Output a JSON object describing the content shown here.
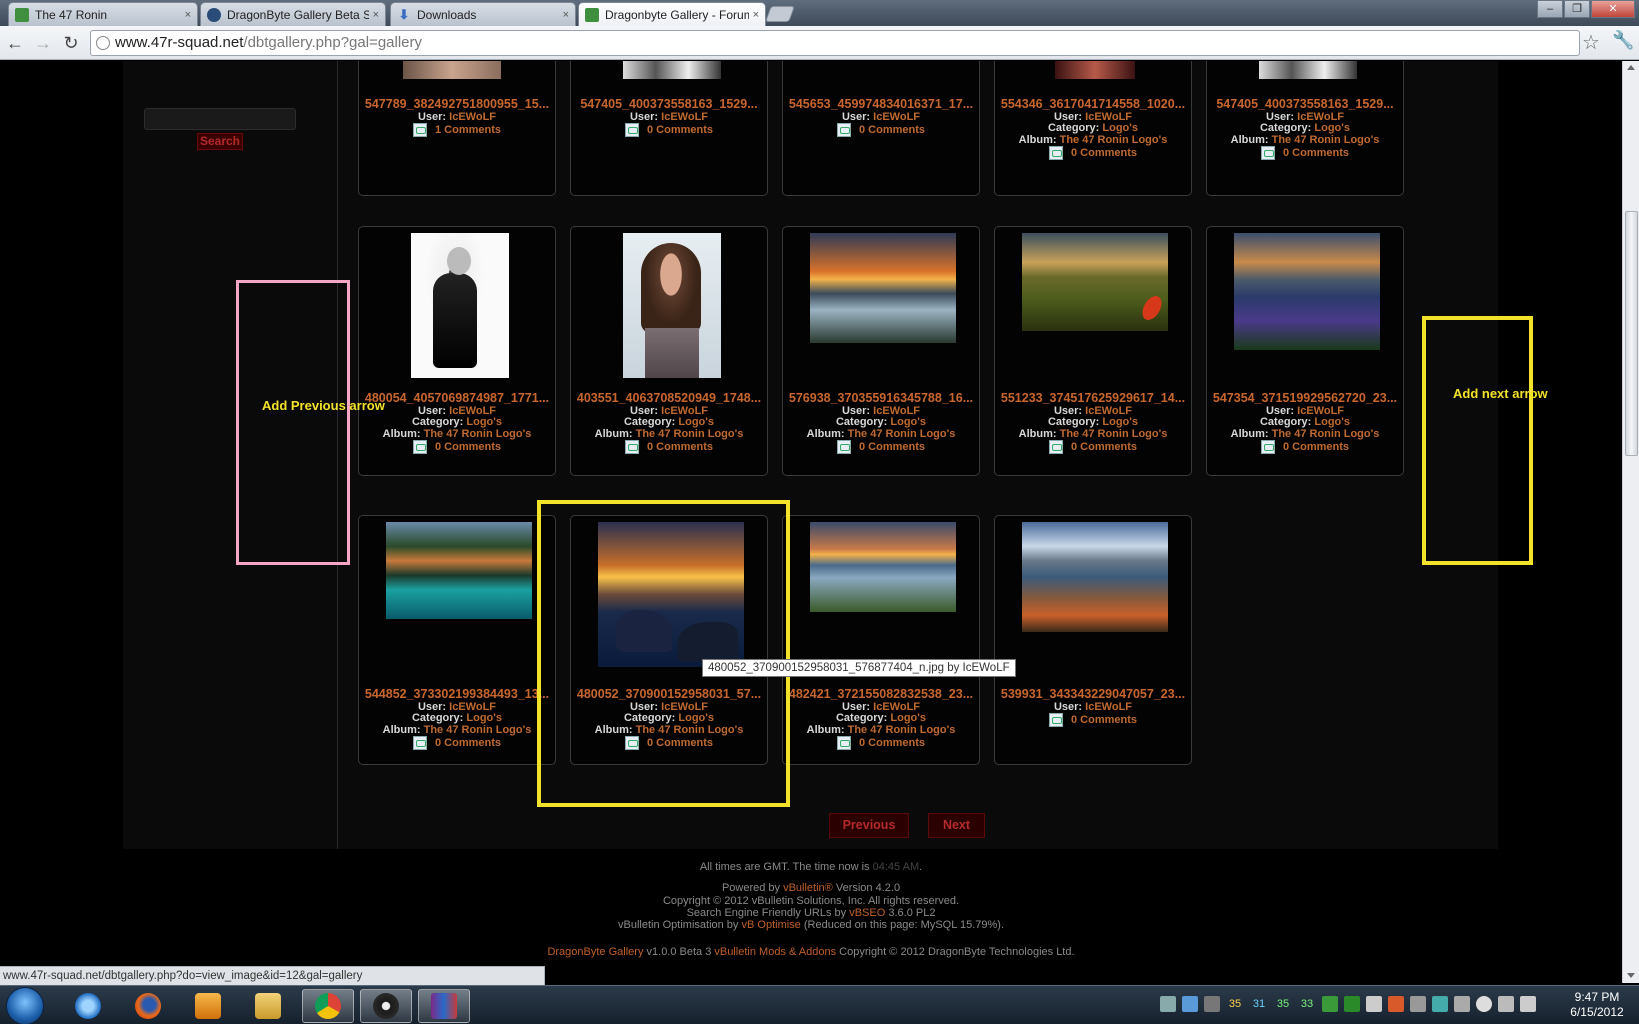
{
  "browser": {
    "tabs": [
      {
        "label": "The 47 Ronin",
        "favicon_color": "#3f8f3f"
      },
      {
        "label": "DragonByte Gallery Beta Su",
        "favicon_color": "#2a4c78"
      },
      {
        "label": "Downloads",
        "favicon_color": "#3b6ec2"
      },
      {
        "label": "Dragonbyte Gallery - Forum",
        "favicon_color": "#3f8f3f"
      }
    ],
    "tab_close_glyph": "×",
    "address_host": "www.47r-squad.net",
    "address_path": "/dbtgallery.php?gal=gallery"
  },
  "sidebar": {
    "search_button": "Search"
  },
  "gallery": {
    "row1": [
      {
        "title": "547789_382492751800955_15...",
        "user_label": "User:",
        "user": "IcEWoLF",
        "comments": "1 Comments"
      },
      {
        "title": "547405_400373558163_1529...",
        "user_label": "User:",
        "user": "IcEWoLF",
        "comments": "0 Comments"
      },
      {
        "title": "545653_459974834016371_17...",
        "user_label": "User:",
        "user": "IcEWoLF",
        "comments": "0 Comments"
      },
      {
        "title": "554346_3617041714558_1020...",
        "user_label": "User:",
        "user": "IcEWoLF",
        "category_label": "Category:",
        "category": "Logo's",
        "album_label": "Album:",
        "album": "The 47 Ronin Logo's",
        "comments": "0 Comments"
      },
      {
        "title": "547405_400373558163_1529...",
        "user_label": "User:",
        "user": "IcEWoLF",
        "category_label": "Category:",
        "category": "Logo's",
        "album_label": "Album:",
        "album": "The 47 Ronin Logo's",
        "comments": "0 Comments"
      }
    ],
    "row2": [
      {
        "title": "480054_4057069874987_1771...",
        "user_label": "User:",
        "user": "IcEWoLF",
        "category_label": "Category:",
        "category": "Logo's",
        "album_label": "Album:",
        "album": "The 47 Ronin Logo's",
        "comments": "0 Comments"
      },
      {
        "title": "403551_4063708520949_1748...",
        "user_label": "User:",
        "user": "IcEWoLF",
        "category_label": "Category:",
        "category": "Logo's",
        "album_label": "Album:",
        "album": "The 47 Ronin Logo's",
        "comments": "0 Comments"
      },
      {
        "title": "576938_370355916345788_16...",
        "user_label": "User:",
        "user": "IcEWoLF",
        "category_label": "Category:",
        "category": "Logo's",
        "album_label": "Album:",
        "album": "The 47 Ronin Logo's",
        "comments": "0 Comments"
      },
      {
        "title": "551233_374517625929617_14...",
        "user_label": "User:",
        "user": "IcEWoLF",
        "category_label": "Category:",
        "category": "Logo's",
        "album_label": "Album:",
        "album": "The 47 Ronin Logo's",
        "comments": "0 Comments"
      },
      {
        "title": "547354_371519929562720_23...",
        "user_label": "User:",
        "user": "IcEWoLF",
        "category_label": "Category:",
        "category": "Logo's",
        "album_label": "Album:",
        "album": "The 47 Ronin Logo's",
        "comments": "0 Comments"
      }
    ],
    "row3": [
      {
        "title": "544852_373302199384493_13...",
        "user_label": "User:",
        "user": "IcEWoLF",
        "category_label": "Category:",
        "category": "Logo's",
        "album_label": "Album:",
        "album": "The 47 Ronin Logo's",
        "comments": "0 Comments"
      },
      {
        "title": "480052_370900152958031_57...",
        "user_label": "User:",
        "user": "IcEWoLF",
        "category_label": "Category:",
        "category": "Logo's",
        "album_label": "Album:",
        "album": "The 47 Ronin Logo's",
        "comments": "0 Comments"
      },
      {
        "title": "482421_372155082832538_23...",
        "user_label": "User:",
        "user": "IcEWoLF",
        "category_label": "Category:",
        "category": "Logo's",
        "album_label": "Album:",
        "album": "The 47 Ronin Logo's",
        "comments": "0 Comments"
      },
      {
        "title": "539931_343343229047057_23...",
        "user_label": "User:",
        "user": "IcEWoLF",
        "comments": "0 Comments"
      }
    ],
    "tooltip": "480052_370900152958031_576877404_n.jpg by IcEWoLF"
  },
  "pager": {
    "previous": "Previous",
    "next": "Next"
  },
  "annotations": {
    "previous": "Add Previous arrow",
    "next": "Add next arrow",
    "pink": "#f4a6c4",
    "yellow": "#f2e22a"
  },
  "footer": {
    "time_prefix": "All times are GMT. The time now is",
    "time_value": "04:45 AM",
    "time_suffix": ".",
    "powered_prefix": "Powered by",
    "powered_link": "vBulletin®",
    "powered_version": "Version 4.2.0",
    "copyright": "Copyright © 2012 vBulletin Solutions, Inc. All rights reserved.",
    "seo_prefix": "Search Engine Friendly URLs by",
    "seo_link": "vBSEO",
    "seo_version": "3.6.0 PL2",
    "opt_prefix": "vBulletin Optimisation by",
    "opt_link": "vB Optimise",
    "opt_suffix": "(Reduced on this page: MySQL 15.79%).",
    "db_link": "DragonByte Gallery",
    "db_version": "v1.0.0 Beta 3",
    "db_mods_link": "vBulletin Mods & Addons",
    "db_copyright": "Copyright © 2012 DragonByte Technologies Ltd."
  },
  "status_url": "www.47r-squad.net/dbtgallery.php?do=view_image&id=12&gal=gallery",
  "taskbar": {
    "tray_numbers": [
      "35",
      "31",
      "35",
      "33"
    ],
    "time": "9:47 PM",
    "date": "6/15/2012"
  }
}
